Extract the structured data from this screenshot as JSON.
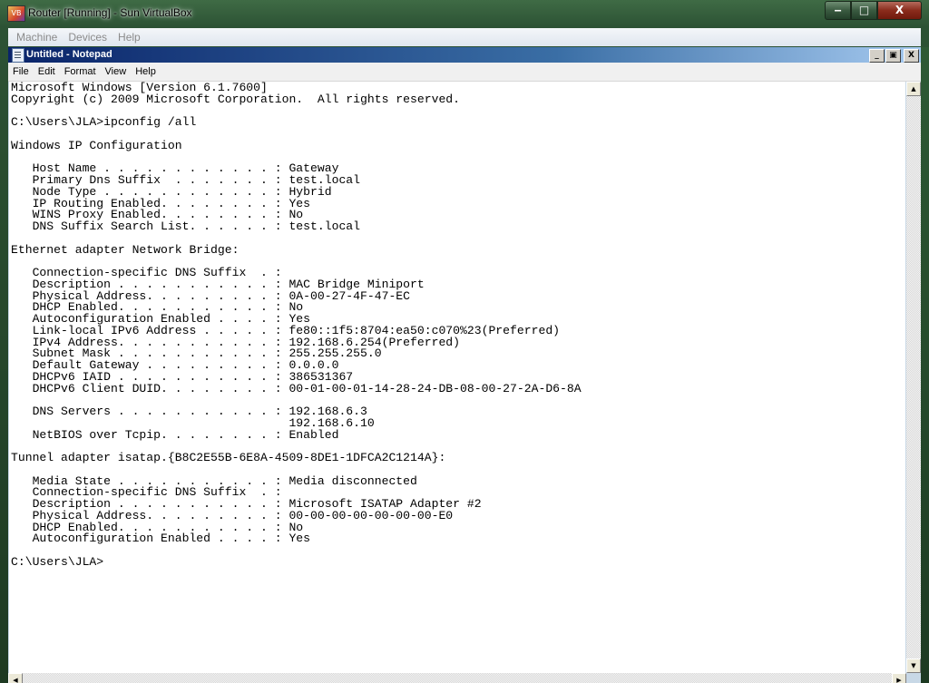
{
  "vbox": {
    "title": "Router [Running] - Sun VirtualBox",
    "app_icon_label": "VB",
    "caption": {
      "minimize": "‒",
      "maximize": "□",
      "close": "X"
    },
    "menu": [
      "Machine",
      "Devices",
      "Help"
    ]
  },
  "notepad": {
    "title": "Untitled - Notepad",
    "caption": {
      "minimize": "_",
      "restore": "▣",
      "close": "X"
    },
    "menu": [
      "File",
      "Edit",
      "Format",
      "View",
      "Help"
    ],
    "content": "Microsoft Windows [Version 6.1.7600]\nCopyright (c) 2009 Microsoft Corporation.  All rights reserved.\n\nC:\\Users\\JLA>ipconfig /all\n\nWindows IP Configuration\n\n   Host Name . . . . . . . . . . . . : Gateway\n   Primary Dns Suffix  . . . . . . . : test.local\n   Node Type . . . . . . . . . . . . : Hybrid\n   IP Routing Enabled. . . . . . . . : Yes\n   WINS Proxy Enabled. . . . . . . . : No\n   DNS Suffix Search List. . . . . . : test.local\n\nEthernet adapter Network Bridge:\n\n   Connection-specific DNS Suffix  . :\n   Description . . . . . . . . . . . : MAC Bridge Miniport\n   Physical Address. . . . . . . . . : 0A-00-27-4F-47-EC\n   DHCP Enabled. . . . . . . . . . . : No\n   Autoconfiguration Enabled . . . . : Yes\n   Link-local IPv6 Address . . . . . : fe80::1f5:8704:ea50:c070%23(Preferred)\n   IPv4 Address. . . . . . . . . . . : 192.168.6.254(Preferred)\n   Subnet Mask . . . . . . . . . . . : 255.255.255.0\n   Default Gateway . . . . . . . . . : 0.0.0.0\n   DHCPv6 IAID . . . . . . . . . . . : 386531367\n   DHCPv6 Client DUID. . . . . . . . : 00-01-00-01-14-28-24-DB-08-00-27-2A-D6-8A\n\n   DNS Servers . . . . . . . . . . . : 192.168.6.3\n                                       192.168.6.10\n   NetBIOS over Tcpip. . . . . . . . : Enabled\n\nTunnel adapter isatap.{B8C2E55B-6E8A-4509-8DE1-1DFCA2C1214A}:\n\n   Media State . . . . . . . . . . . : Media disconnected\n   Connection-specific DNS Suffix  . :\n   Description . . . . . . . . . . . : Microsoft ISATAP Adapter #2\n   Physical Address. . . . . . . . . : 00-00-00-00-00-00-00-E0\n   DHCP Enabled. . . . . . . . . . . : No\n   Autoconfiguration Enabled . . . . : Yes\n\nC:\\Users\\JLA>"
  },
  "scrollbar": {
    "up": "▲",
    "down": "▼",
    "left": "◀",
    "right": "▶"
  }
}
